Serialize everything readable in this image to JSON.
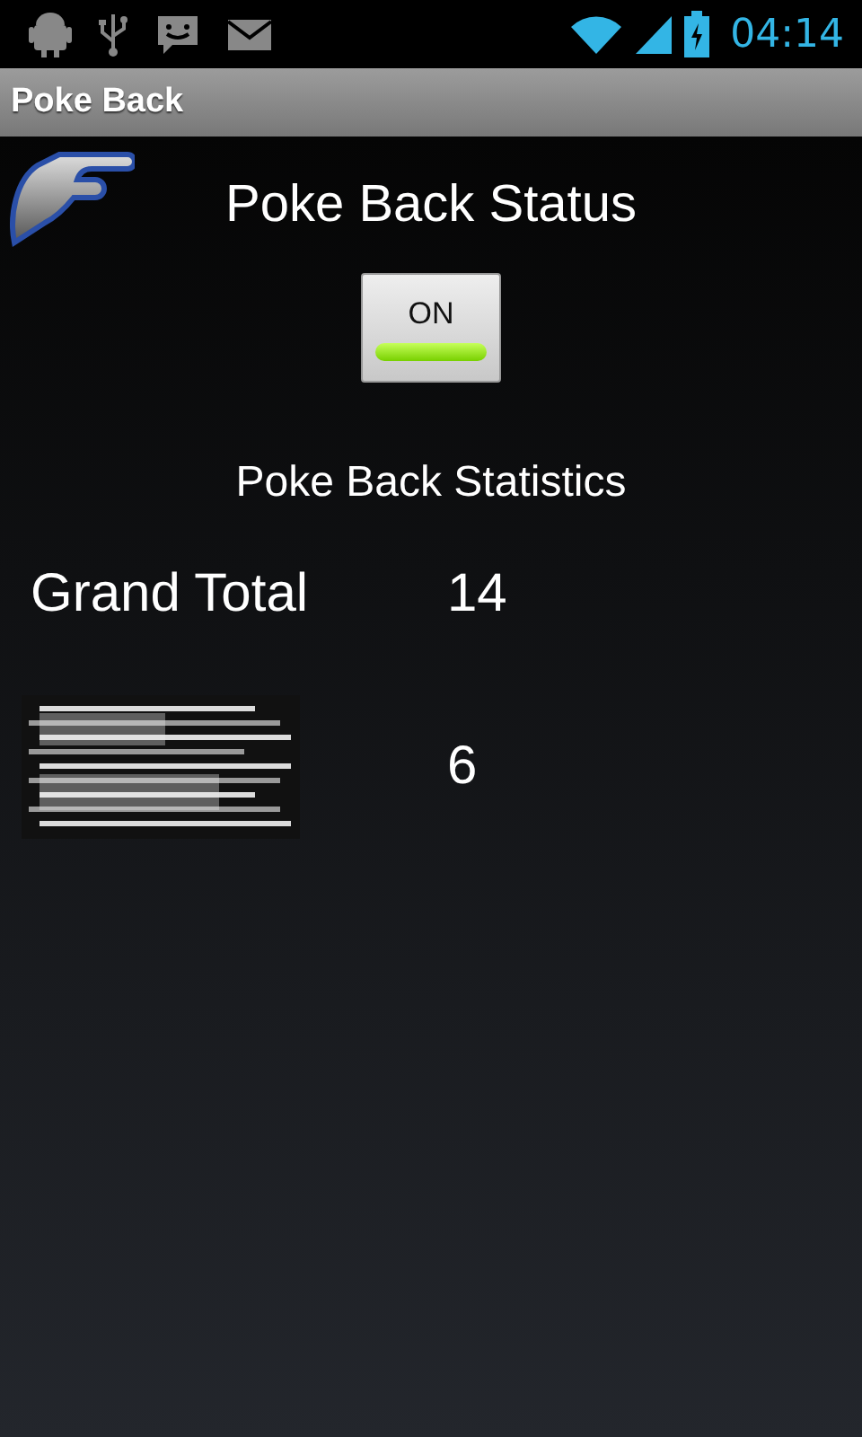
{
  "status_bar": {
    "time": "04:14"
  },
  "window": {
    "title": "Poke Back"
  },
  "header": {
    "title": "Poke Back Status"
  },
  "toggle": {
    "label": "ON",
    "on": true
  },
  "statistics": {
    "title": "Poke Back Statistics",
    "rows": [
      {
        "kind": "text",
        "label": "Grand Total",
        "value": "14"
      },
      {
        "kind": "picture",
        "value": "6"
      }
    ]
  }
}
